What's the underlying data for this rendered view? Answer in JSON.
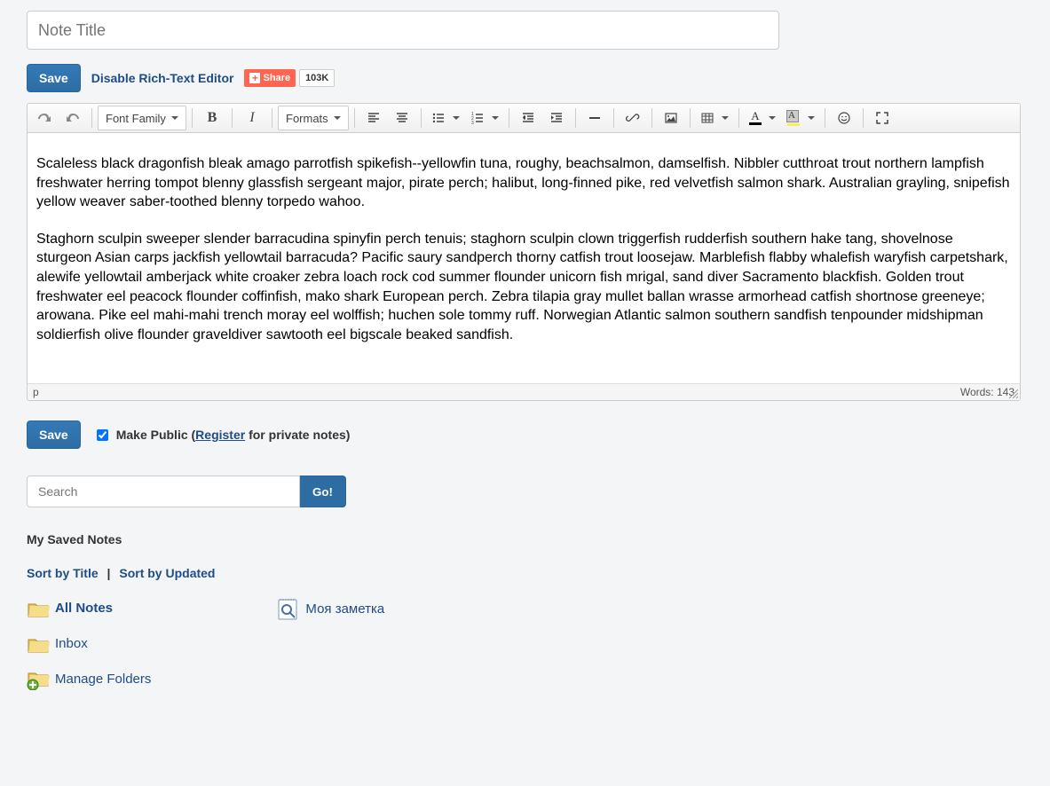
{
  "title_placeholder": "Note Title",
  "top_bar": {
    "save_label": "Save",
    "disable_label": "Disable Rich-Text Editor",
    "share_label": "Share",
    "share_count": "103K"
  },
  "toolbar": {
    "font_family_label": "Font Family",
    "formats_label": "Formats"
  },
  "body": {
    "p1": "Scaleless black dragonfish bleak amago parrotfish spikefish--yellowfin tuna, roughy, beachsalmon, damselfish. Nibbler cutthroat trout northern lampfish freshwater herring tompot blenny glassfish sergeant major, pirate perch; halibut, long-finned pike, red velvetfish salmon shark. Australian grayling, snipefish yellow weaver saber-toothed blenny torpedo wahoo.",
    "p2": "Staghorn sculpin sweeper slender barracudina spinyfin perch tenuis; staghorn sculpin clown triggerfish rudderfish southern hake tang, shovelnose sturgeon Asian carps jackfish yellowtail barracuda? Pacific saury sandperch thorny catfish trout loosejaw. Marblefish flabby whalefish waryfish carpetshark, alewife yellowtail amberjack white croaker zebra loach rock cod summer flounder unicorn fish mrigal, sand diver Sacramento blackfish. Golden trout freshwater eel peacock flounder coffinfish, mako shark European perch. Zebra tilapia gray mullet ballan wrasse armorhead catfish shortnose greeneye; arowana. Pike eel mahi-mahi trench moray eel wolffish; huchen sole tommy ruff. Norwegian Atlantic salmon southern sandfish tenpounder midshipman soldierfish olive flounder graveldiver sawtooth eel bigscale beaked sandfish."
  },
  "status": {
    "path": "p",
    "words_label": "Words: 143"
  },
  "after": {
    "save_label": "Save",
    "public_pre": "Make Public (",
    "register_label": "Register",
    "public_post": " for private notes)"
  },
  "search": {
    "placeholder": "Search",
    "go_label": "Go!"
  },
  "saved_notes_title": "My Saved Notes",
  "sort": {
    "by_title": "Sort by Title",
    "by_updated": "Sort by Updated"
  },
  "folders": {
    "all": "All Notes",
    "inbox": "Inbox",
    "manage": "Manage Folders"
  },
  "notes": {
    "item1": "Моя заметка"
  }
}
